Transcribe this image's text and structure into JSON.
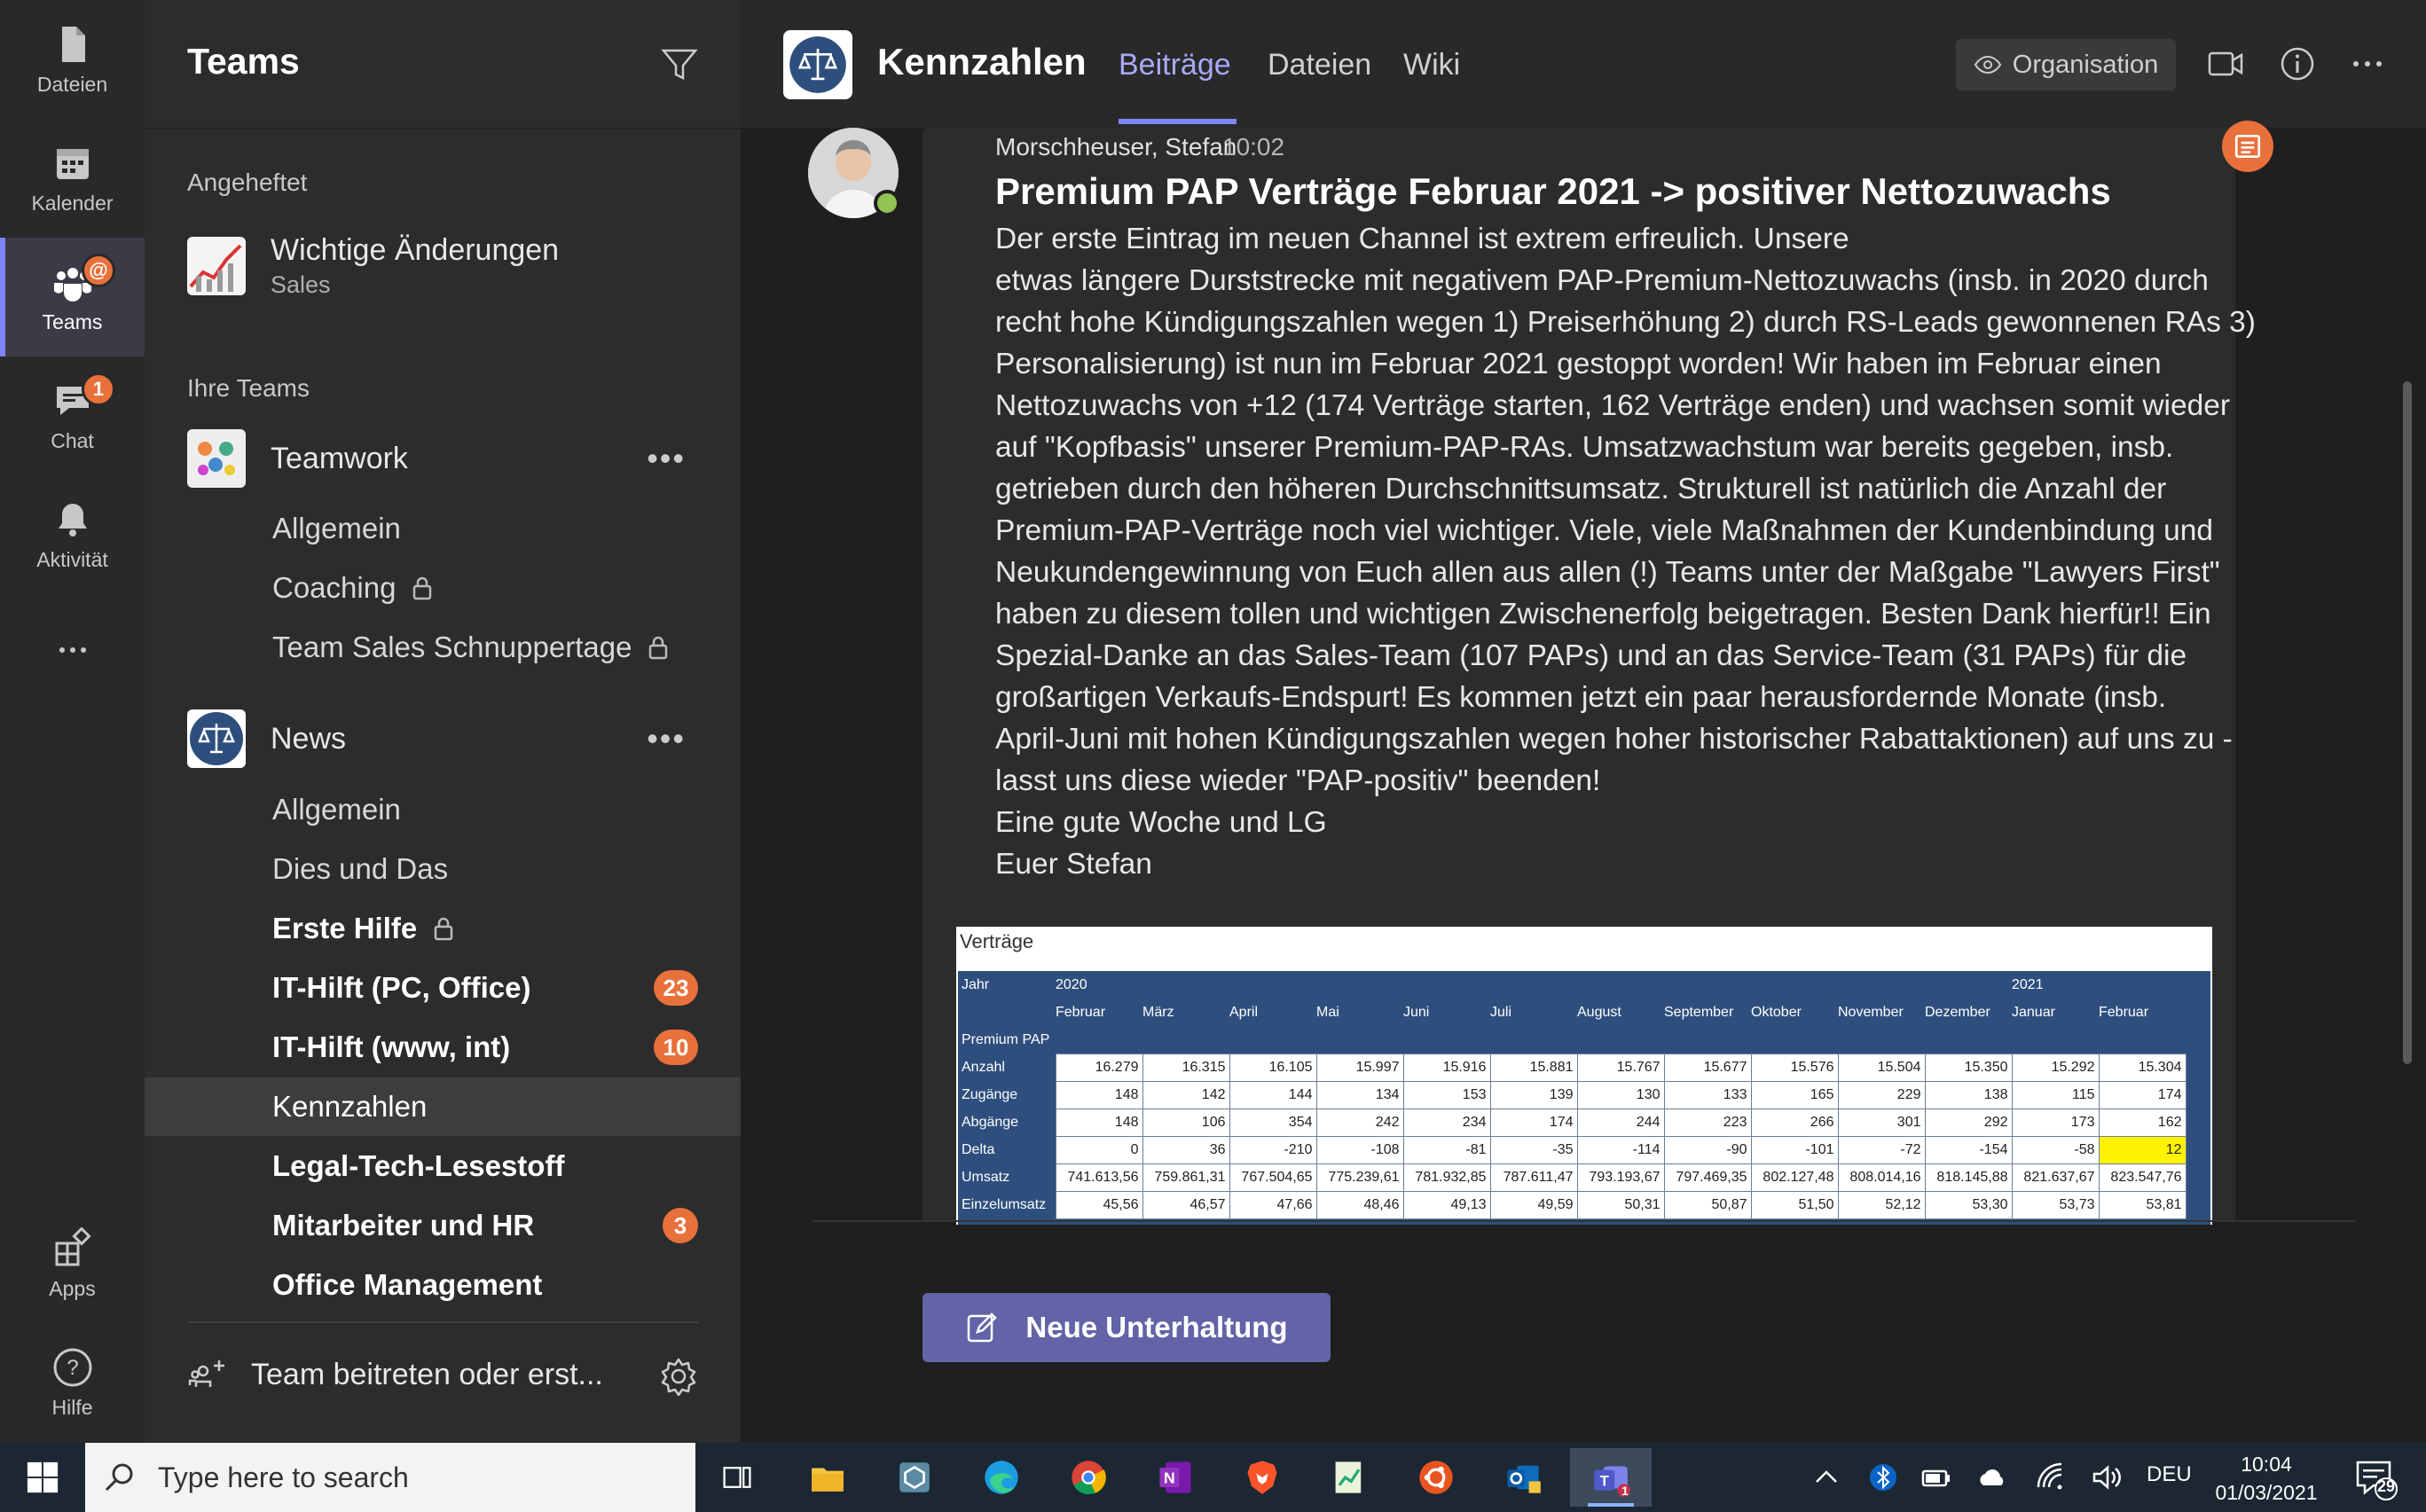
{
  "rail": {
    "items": [
      {
        "label": "Dateien",
        "icon": "file-icon"
      },
      {
        "label": "Kalender",
        "icon": "calendar-icon"
      },
      {
        "label": "Teams",
        "icon": "teams-icon",
        "badge": "@"
      },
      {
        "label": "Chat",
        "icon": "chat-icon",
        "badge": "1"
      },
      {
        "label": "Aktivität",
        "icon": "bell-icon"
      },
      {
        "label": "...",
        "icon": "more-icon"
      },
      {
        "label": "Apps",
        "icon": "apps-icon"
      },
      {
        "label": "Hilfe",
        "icon": "help-icon"
      }
    ]
  },
  "panel": {
    "title": "Teams",
    "pinned_label": "Angeheftet",
    "pinned": {
      "name": "Wichtige Änderungen",
      "sub": "Sales"
    },
    "your_teams_label": "Ihre Teams",
    "teams": [
      {
        "name": "Teamwork",
        "channels": [
          {
            "name": "Allgemein"
          },
          {
            "name": "Coaching",
            "locked": true
          },
          {
            "name": "Team Sales Schnuppertage",
            "locked": true
          }
        ]
      },
      {
        "name": "News",
        "channels": [
          {
            "name": "Allgemein"
          },
          {
            "name": "Dies und Das"
          },
          {
            "name": "Erste Hilfe",
            "locked": true,
            "bold": true
          },
          {
            "name": "IT-Hilft (PC, Office)",
            "bold": true,
            "badge": "23"
          },
          {
            "name": "IT-Hilft (www, int)",
            "bold": true,
            "badge": "10"
          },
          {
            "name": "Kennzahlen",
            "active": true
          },
          {
            "name": "Legal-Tech-Lesestoff",
            "bold": true
          },
          {
            "name": "Mitarbeiter und HR",
            "bold": true,
            "badge": "3"
          },
          {
            "name": "Office Management",
            "bold": true
          }
        ]
      }
    ],
    "join_label": "Team beitreten oder erst..."
  },
  "header": {
    "channel": "Kennzahlen",
    "tabs": [
      "Beiträge",
      "Dateien",
      "Wiki"
    ],
    "active_tab": "Beiträge",
    "org_label": "Organisation"
  },
  "post": {
    "author": "Morschheuser, Stefan",
    "time": "10:02",
    "title": "Premium PAP Verträge Februar 2021 -> positiver Nettozuwachs",
    "lines": [
      "Der erste Eintrag im neuen Channel ist extrem erfreulich. Unsere",
      "etwas längere Durststrecke mit negativem PAP-Premium-Nettozuwachs  (insb. in 2020 durch",
      "recht hohe Kündigungszahlen wegen 1) Preiserhöhung 2) durch RS-Leads gewonnenen RAs 3)",
      "Personalisierung) ist nun im Februar 2021 gestoppt worden! Wir haben im Februar einen",
      "Nettozuwachs von +12 (174 Verträge starten, 162  Verträge enden) und wachsen somit wieder",
      "auf \"Kopfbasis\" unserer Premium-PAP-RAs. Umsatzwachstum war bereits gegeben, insb.",
      "getrieben durch den höheren Durchschnittsumsatz. Strukturell ist natürlich die Anzahl der",
      "Premium-PAP-Verträge noch viel wichtiger. Viele, viele Maßnahmen der Kundenbindung und",
      "Neukundengewinnung von Euch allen aus allen (!) Teams unter der Maßgabe \"Lawyers First\"",
      "haben zu diesem tollen und wichtigen Zwischenerfolg beigetragen. Besten Dank hierfür!! Ein",
      "Spezial-Danke an das Sales-Team (107 PAPs) und an das Service-Team (31 PAPs) für die",
      "großartigen Verkaufs-Endspurt! Es kommen jetzt ein paar herausfordernde Monate (insb.",
      "April-Juni mit hohen Kündigungszahlen wegen hoher historischer Rabattaktionen) auf uns zu -",
      "lasst uns diese wieder \"PAP-positiv\" beenden!",
      "Eine gute Woche und LG",
      "Euer Stefan"
    ]
  },
  "table": {
    "title": "Verträge",
    "col_label": "Jahr",
    "year_2020": "2020",
    "year_2021": "2021",
    "months": [
      "Februar",
      "März",
      "April",
      "Mai",
      "Juni",
      "Juli",
      "August",
      "September",
      "Oktober",
      "November",
      "Dezember",
      "Januar",
      "Februar"
    ],
    "section": "Premium PAP",
    "rows": [
      {
        "label": "Anzahl",
        "values": [
          "16.279",
          "16.315",
          "16.105",
          "15.997",
          "15.916",
          "15.881",
          "15.767",
          "15.677",
          "15.576",
          "15.504",
          "15.350",
          "15.292",
          "15.304"
        ]
      },
      {
        "label": "Zugänge",
        "values": [
          "148",
          "142",
          "144",
          "134",
          "153",
          "139",
          "130",
          "133",
          "165",
          "229",
          "138",
          "115",
          "174"
        ]
      },
      {
        "label": "Abgänge",
        "values": [
          "148",
          "106",
          "354",
          "242",
          "234",
          "174",
          "244",
          "223",
          "266",
          "301",
          "292",
          "173",
          "162"
        ]
      },
      {
        "label": "Delta",
        "values": [
          "0",
          "36",
          "-210",
          "-108",
          "-81",
          "-35",
          "-114",
          "-90",
          "-101",
          "-72",
          "-154",
          "-58",
          "12"
        ]
      },
      {
        "label": "Umsatz",
        "values": [
          "741.613,56",
          "759.861,31",
          "767.504,65",
          "775.239,61",
          "781.932,85",
          "787.611,47",
          "793.193,67",
          "797.469,35",
          "802.127,48",
          "808.014,16",
          "818.145,88",
          "821.637,67",
          "823.547,76"
        ]
      },
      {
        "label": "Einzelumsatz",
        "values": [
          "45,56",
          "46,57",
          "47,66",
          "48,46",
          "49,13",
          "49,59",
          "50,31",
          "50,87",
          "51,50",
          "52,12",
          "53,30",
          "53,73",
          "53,81"
        ]
      }
    ]
  },
  "new_conversation": "Neue Unterhaltung",
  "taskbar": {
    "search_placeholder": "Type here to search",
    "lang": "DEU",
    "time": "10:04",
    "date": "01/03/2021",
    "notif_count": "29",
    "teams_badge": "1"
  },
  "colors": {
    "accent": "#7f85f5",
    "badge": "#e8703a",
    "button": "#6264a7",
    "highlight": "#fff200"
  }
}
